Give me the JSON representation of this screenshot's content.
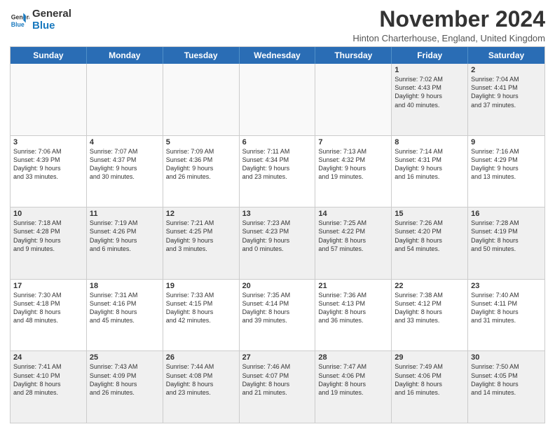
{
  "logo": {
    "line1": "General",
    "line2": "Blue"
  },
  "title": "November 2024",
  "subtitle": "Hinton Charterhouse, England, United Kingdom",
  "header_days": [
    "Sunday",
    "Monday",
    "Tuesday",
    "Wednesday",
    "Thursday",
    "Friday",
    "Saturday"
  ],
  "rows": [
    [
      {
        "day": "",
        "text": "",
        "empty": true
      },
      {
        "day": "",
        "text": "",
        "empty": true
      },
      {
        "day": "",
        "text": "",
        "empty": true
      },
      {
        "day": "",
        "text": "",
        "empty": true
      },
      {
        "day": "",
        "text": "",
        "empty": true
      },
      {
        "day": "1",
        "text": "Sunrise: 7:02 AM\nSunset: 4:43 PM\nDaylight: 9 hours\nand 40 minutes.",
        "empty": false
      },
      {
        "day": "2",
        "text": "Sunrise: 7:04 AM\nSunset: 4:41 PM\nDaylight: 9 hours\nand 37 minutes.",
        "empty": false
      }
    ],
    [
      {
        "day": "3",
        "text": "Sunrise: 7:06 AM\nSunset: 4:39 PM\nDaylight: 9 hours\nand 33 minutes.",
        "empty": false
      },
      {
        "day": "4",
        "text": "Sunrise: 7:07 AM\nSunset: 4:37 PM\nDaylight: 9 hours\nand 30 minutes.",
        "empty": false
      },
      {
        "day": "5",
        "text": "Sunrise: 7:09 AM\nSunset: 4:36 PM\nDaylight: 9 hours\nand 26 minutes.",
        "empty": false
      },
      {
        "day": "6",
        "text": "Sunrise: 7:11 AM\nSunset: 4:34 PM\nDaylight: 9 hours\nand 23 minutes.",
        "empty": false
      },
      {
        "day": "7",
        "text": "Sunrise: 7:13 AM\nSunset: 4:32 PM\nDaylight: 9 hours\nand 19 minutes.",
        "empty": false
      },
      {
        "day": "8",
        "text": "Sunrise: 7:14 AM\nSunset: 4:31 PM\nDaylight: 9 hours\nand 16 minutes.",
        "empty": false
      },
      {
        "day": "9",
        "text": "Sunrise: 7:16 AM\nSunset: 4:29 PM\nDaylight: 9 hours\nand 13 minutes.",
        "empty": false
      }
    ],
    [
      {
        "day": "10",
        "text": "Sunrise: 7:18 AM\nSunset: 4:28 PM\nDaylight: 9 hours\nand 9 minutes.",
        "empty": false
      },
      {
        "day": "11",
        "text": "Sunrise: 7:19 AM\nSunset: 4:26 PM\nDaylight: 9 hours\nand 6 minutes.",
        "empty": false
      },
      {
        "day": "12",
        "text": "Sunrise: 7:21 AM\nSunset: 4:25 PM\nDaylight: 9 hours\nand 3 minutes.",
        "empty": false
      },
      {
        "day": "13",
        "text": "Sunrise: 7:23 AM\nSunset: 4:23 PM\nDaylight: 9 hours\nand 0 minutes.",
        "empty": false
      },
      {
        "day": "14",
        "text": "Sunrise: 7:25 AM\nSunset: 4:22 PM\nDaylight: 8 hours\nand 57 minutes.",
        "empty": false
      },
      {
        "day": "15",
        "text": "Sunrise: 7:26 AM\nSunset: 4:20 PM\nDaylight: 8 hours\nand 54 minutes.",
        "empty": false
      },
      {
        "day": "16",
        "text": "Sunrise: 7:28 AM\nSunset: 4:19 PM\nDaylight: 8 hours\nand 50 minutes.",
        "empty": false
      }
    ],
    [
      {
        "day": "17",
        "text": "Sunrise: 7:30 AM\nSunset: 4:18 PM\nDaylight: 8 hours\nand 48 minutes.",
        "empty": false
      },
      {
        "day": "18",
        "text": "Sunrise: 7:31 AM\nSunset: 4:16 PM\nDaylight: 8 hours\nand 45 minutes.",
        "empty": false
      },
      {
        "day": "19",
        "text": "Sunrise: 7:33 AM\nSunset: 4:15 PM\nDaylight: 8 hours\nand 42 minutes.",
        "empty": false
      },
      {
        "day": "20",
        "text": "Sunrise: 7:35 AM\nSunset: 4:14 PM\nDaylight: 8 hours\nand 39 minutes.",
        "empty": false
      },
      {
        "day": "21",
        "text": "Sunrise: 7:36 AM\nSunset: 4:13 PM\nDaylight: 8 hours\nand 36 minutes.",
        "empty": false
      },
      {
        "day": "22",
        "text": "Sunrise: 7:38 AM\nSunset: 4:12 PM\nDaylight: 8 hours\nand 33 minutes.",
        "empty": false
      },
      {
        "day": "23",
        "text": "Sunrise: 7:40 AM\nSunset: 4:11 PM\nDaylight: 8 hours\nand 31 minutes.",
        "empty": false
      }
    ],
    [
      {
        "day": "24",
        "text": "Sunrise: 7:41 AM\nSunset: 4:10 PM\nDaylight: 8 hours\nand 28 minutes.",
        "empty": false
      },
      {
        "day": "25",
        "text": "Sunrise: 7:43 AM\nSunset: 4:09 PM\nDaylight: 8 hours\nand 26 minutes.",
        "empty": false
      },
      {
        "day": "26",
        "text": "Sunrise: 7:44 AM\nSunset: 4:08 PM\nDaylight: 8 hours\nand 23 minutes.",
        "empty": false
      },
      {
        "day": "27",
        "text": "Sunrise: 7:46 AM\nSunset: 4:07 PM\nDaylight: 8 hours\nand 21 minutes.",
        "empty": false
      },
      {
        "day": "28",
        "text": "Sunrise: 7:47 AM\nSunset: 4:06 PM\nDaylight: 8 hours\nand 19 minutes.",
        "empty": false
      },
      {
        "day": "29",
        "text": "Sunrise: 7:49 AM\nSunset: 4:06 PM\nDaylight: 8 hours\nand 16 minutes.",
        "empty": false
      },
      {
        "day": "30",
        "text": "Sunrise: 7:50 AM\nSunset: 4:05 PM\nDaylight: 8 hours\nand 14 minutes.",
        "empty": false
      }
    ]
  ]
}
